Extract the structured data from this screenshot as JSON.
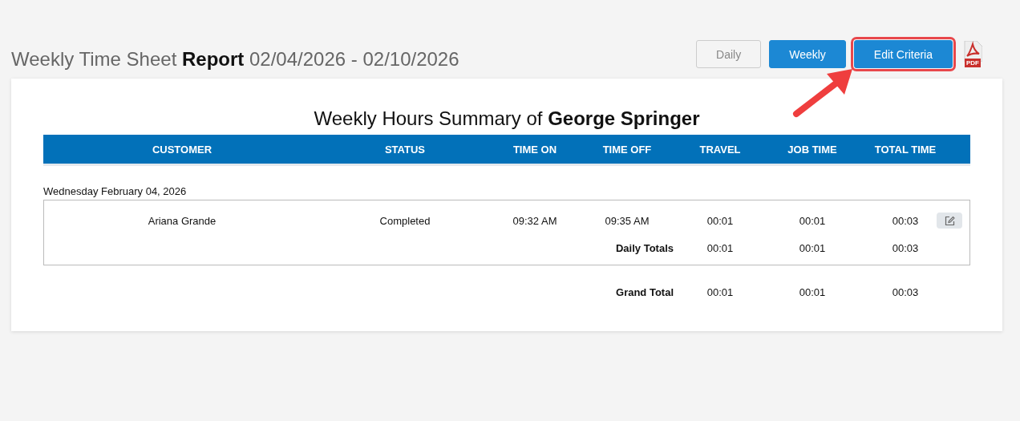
{
  "page": {
    "title": "Weekly Time Sheet **Report** 02/04/2026 - 02/10/2026"
  },
  "view_buttons": [
    {
      "label": "Daily",
      "kind": "toggle",
      "selected": false,
      "highlighted": false
    },
    {
      "label": "Weekly",
      "kind": "toggle",
      "selected": true,
      "highlighted": false
    },
    {
      "label": "Edit Criteria",
      "kind": "action",
      "highlighted": true
    }
  ],
  "pdf_label": "PDF",
  "report": {
    "title": "Weekly Hours Summary of **George Springer**",
    "columns": [
      "CUSTOMER",
      "STATUS",
      "TIME ON",
      "TIME OFF",
      "TRAVEL",
      "JOB TIME",
      "TOTAL TIME"
    ],
    "days": [
      {
        "date": "Wednesday February 04, 2026",
        "rows": [
          {
            "cells": [
              "Ariana Grande",
              "Completed",
              "09:32 AM",
              "09:35 AM",
              "00:01",
              "00:01",
              "00:03"
            ]
          }
        ],
        "totals_label": "Daily Totals",
        "totals": [
          "00:01",
          "00:01",
          "00:03"
        ]
      }
    ],
    "grand_total": {
      "label": "Grand Total",
      "values": [
        "00:01",
        "00:01",
        "00:03"
      ]
    }
  }
}
